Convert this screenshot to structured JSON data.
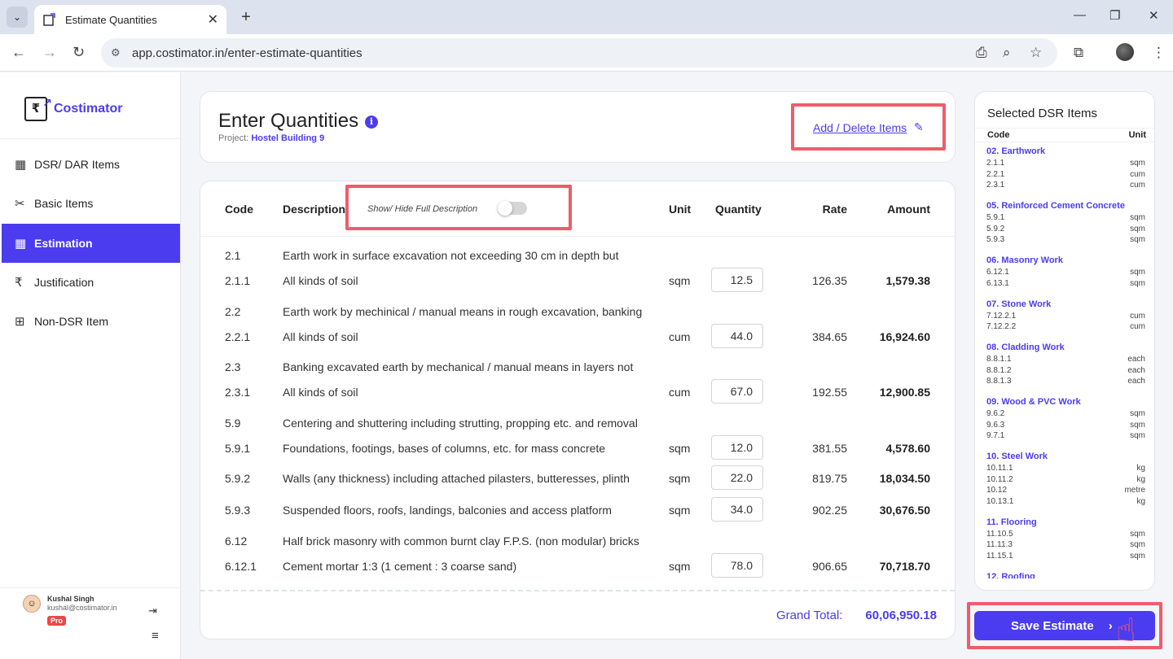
{
  "browser": {
    "tab_title": "Estimate Quantities",
    "tab_close": "✕",
    "new_tab": "+",
    "url": "app.costimator.in/enter-estimate-quantities",
    "minimize": "—",
    "restore": "❐",
    "close": "✕"
  },
  "sidebar": {
    "brand": "Costimator",
    "logo_symbol": "₹",
    "items": [
      {
        "label": "DSR/ DAR Items",
        "icon": "▦"
      },
      {
        "label": "Basic Items",
        "icon": "✂"
      },
      {
        "label": "Estimation",
        "icon": "▦"
      },
      {
        "label": "Justification",
        "icon": "₹"
      },
      {
        "label": "Non-DSR Item",
        "icon": "⊞"
      }
    ],
    "user": {
      "name": "Kushal Singh",
      "email": "kushal@costimator.in",
      "badge": "Pro"
    }
  },
  "header": {
    "title": "Enter Quantities",
    "project_label": "Project:",
    "project_name": "Hostel Building 9",
    "add_delete": "Add / Delete Items"
  },
  "table": {
    "headers": {
      "code": "Code",
      "description": "Description",
      "unit": "Unit",
      "quantity": "Quantity",
      "rate": "Rate",
      "amount": "Amount"
    },
    "toggle_label": "Show/ Hide Full Description",
    "toggle_on": false,
    "rows": [
      {
        "code": "2.1",
        "description": "Earth work in surface excavation not exceeding 30 cm in depth but",
        "unit": "",
        "quantity": "",
        "rate": "",
        "amount": ""
      },
      {
        "code": "2.1.1",
        "description": "All kinds of soil",
        "unit": "sqm",
        "quantity": "12.5",
        "rate": "126.35",
        "amount": "1,579.38"
      },
      {
        "code": "2.2",
        "description": "Earth work by mechinical / manual means in rough excavation, banking",
        "unit": "",
        "quantity": "",
        "rate": "",
        "amount": ""
      },
      {
        "code": "2.2.1",
        "description": "All kinds of soil",
        "unit": "cum",
        "quantity": "44.0",
        "rate": "384.65",
        "amount": "16,924.60"
      },
      {
        "code": "2.3",
        "description": "Banking excavated earth by mechanical / manual means in layers not",
        "unit": "",
        "quantity": "",
        "rate": "",
        "amount": ""
      },
      {
        "code": "2.3.1",
        "description": "All kinds of soil",
        "unit": "cum",
        "quantity": "67.0",
        "rate": "192.55",
        "amount": "12,900.85"
      },
      {
        "code": "5.9",
        "description": "Centering and shuttering including strutting, propping etc. and removal",
        "unit": "",
        "quantity": "",
        "rate": "",
        "amount": ""
      },
      {
        "code": "5.9.1",
        "description": "Foundations, footings, bases of columns, etc. for mass concrete",
        "unit": "sqm",
        "quantity": "12.0",
        "rate": "381.55",
        "amount": "4,578.60"
      },
      {
        "code": "5.9.2",
        "description": "Walls (any thickness) including attached pilasters, butteresses, plinth",
        "unit": "sqm",
        "quantity": "22.0",
        "rate": "819.75",
        "amount": "18,034.50"
      },
      {
        "code": "5.9.3",
        "description": "Suspended floors, roofs, landings, balconies and access platform",
        "unit": "sqm",
        "quantity": "34.0",
        "rate": "902.25",
        "amount": "30,676.50"
      },
      {
        "code": "6.12",
        "description": "Half brick masonry with common burnt clay F.P.S. (non modular) bricks",
        "unit": "",
        "quantity": "",
        "rate": "",
        "amount": ""
      },
      {
        "code": "6.12.1",
        "description": "Cement mortar 1:3 (1 cement : 3 coarse sand)",
        "unit": "sqm",
        "quantity": "78.0",
        "rate": "906.65",
        "amount": "70,718.70"
      }
    ],
    "grand_total_label": "Grand Total:",
    "grand_total": "60,06,950.18"
  },
  "dsr_panel": {
    "title": "Selected DSR Items",
    "col_code": "Code",
    "col_unit": "Unit",
    "groups": [
      {
        "name": "02. Earthwork",
        "items": [
          {
            "code": "2.1.1",
            "unit": "sqm"
          },
          {
            "code": "2.2.1",
            "unit": "cum"
          },
          {
            "code": "2.3.1",
            "unit": "cum"
          }
        ]
      },
      {
        "name": "05. Reinforced Cement Concrete",
        "items": [
          {
            "code": "5.9.1",
            "unit": "sqm"
          },
          {
            "code": "5.9.2",
            "unit": "sqm"
          },
          {
            "code": "5.9.3",
            "unit": "sqm"
          }
        ]
      },
      {
        "name": "06. Masonry Work",
        "items": [
          {
            "code": "6.12.1",
            "unit": "sqm"
          },
          {
            "code": "6.13.1",
            "unit": "sqm"
          }
        ]
      },
      {
        "name": "07. Stone Work",
        "items": [
          {
            "code": "7.12.2.1",
            "unit": "cum"
          },
          {
            "code": "7.12.2.2",
            "unit": "cum"
          }
        ]
      },
      {
        "name": "08. Cladding Work",
        "items": [
          {
            "code": "8.8.1.1",
            "unit": "each"
          },
          {
            "code": "8.8.1.2",
            "unit": "each"
          },
          {
            "code": "8.8.1.3",
            "unit": "each"
          }
        ]
      },
      {
        "name": "09. Wood & PVC Work",
        "items": [
          {
            "code": "9.6.2",
            "unit": "sqm"
          },
          {
            "code": "9.6.3",
            "unit": "sqm"
          },
          {
            "code": "9.7.1",
            "unit": "sqm"
          }
        ]
      },
      {
        "name": "10. Steel Work",
        "items": [
          {
            "code": "10.11.1",
            "unit": "kg"
          },
          {
            "code": "10.11.2",
            "unit": "kg"
          },
          {
            "code": "10.12",
            "unit": "metre"
          },
          {
            "code": "10.13.1",
            "unit": "kg"
          }
        ]
      },
      {
        "name": "11. Flooring",
        "items": [
          {
            "code": "11.10.5",
            "unit": "sqm"
          },
          {
            "code": "11.11.3",
            "unit": "sqm"
          },
          {
            "code": "11.15.1",
            "unit": "sqm"
          }
        ]
      },
      {
        "name": "12. Roofing",
        "items": []
      }
    ]
  },
  "save_button": "Save Estimate",
  "colors": {
    "accent": "#4b3cf0",
    "highlight": "#f05c6a"
  }
}
